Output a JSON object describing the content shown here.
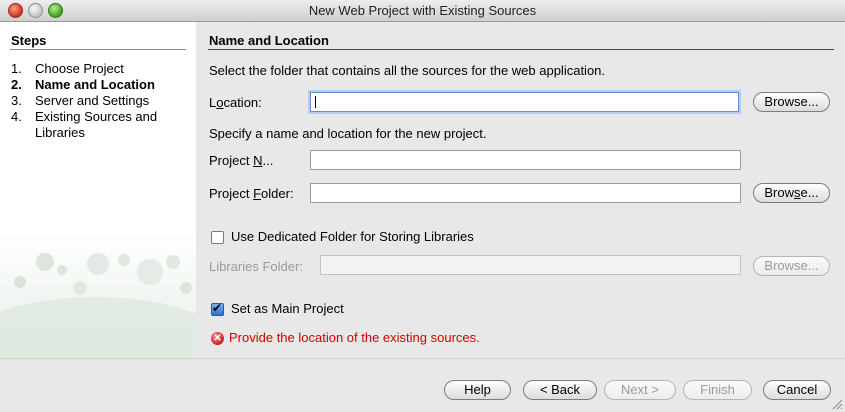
{
  "window": {
    "title": "New Web Project with Existing Sources"
  },
  "steps": {
    "title": "Steps",
    "items": [
      {
        "num": "1.",
        "label": "Choose Project"
      },
      {
        "num": "2.",
        "label": "Name and Location"
      },
      {
        "num": "3.",
        "label": "Server and Settings"
      },
      {
        "num": "4.",
        "label": "Existing Sources and Libraries"
      }
    ],
    "active_index": 1
  },
  "main": {
    "section_title": "Name and Location",
    "instruction": "Select the folder that contains all the sources for the web application.",
    "location": {
      "label_pre": "L",
      "label_mnemonic": "o",
      "label_post": "cation:",
      "value": ""
    },
    "browse_label": "Browse...",
    "project_instruction": "Specify a name and location for the new project.",
    "project_name": {
      "label_pre": "Project ",
      "label_mnemonic": "N",
      "label_post": "...",
      "value": ""
    },
    "project_folder": {
      "label_pre": "Project ",
      "label_mnemonic": "F",
      "label_post": "older:",
      "value": ""
    },
    "browse2": {
      "pre": "Brow",
      "mnemonic": "s",
      "post": "e..."
    },
    "dedicated_folder": {
      "label": "Use Dedicated Folder for Storing Libraries",
      "checked": false
    },
    "libraries_folder": {
      "label": "Libraries Folder:",
      "value": ""
    },
    "browse3_label": "Browse...",
    "main_project": {
      "label": "Set as Main Project",
      "checked": true
    },
    "error_message": "Provide the location of the existing sources."
  },
  "buttons": {
    "help": "Help",
    "back": "< Back",
    "next": "Next >",
    "finish": "Finish",
    "cancel": "Cancel"
  }
}
